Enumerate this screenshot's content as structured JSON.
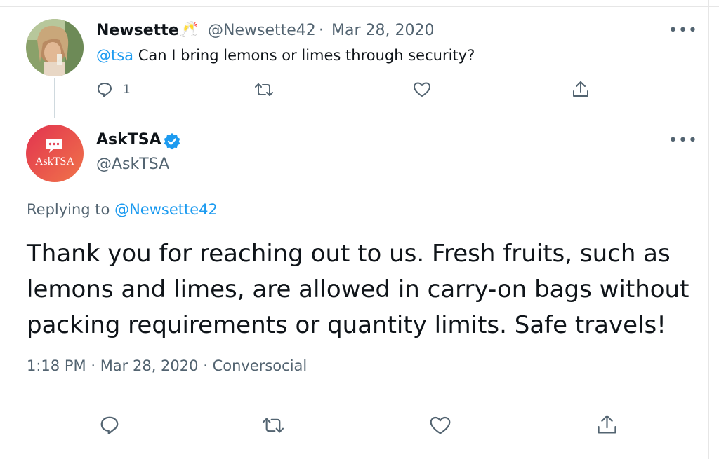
{
  "original_tweet": {
    "display_name": "Newsette",
    "emoji": "🥂",
    "handle": "@Newsette42",
    "separator": "·",
    "date": "Mar 28, 2020",
    "mention": "@tsa",
    "text": "Can I bring lemons or limes through security?",
    "reply_count": "1",
    "more_label": "•••"
  },
  "reply_tweet": {
    "display_name": "AskTSA",
    "verified_icon": "verified-badge-icon",
    "handle": "@AskTSA",
    "avatar_text": "AskTSA",
    "more_label": "•••",
    "replying_prefix": "Replying to",
    "replying_handle": "@Newsette42",
    "text": "Thank you for reaching out to us. Fresh fruits, such as lemons and limes, are allowed in carry-on bags without packing requirements or quantity limits. Safe travels!",
    "time": "1:18 PM",
    "date": "Mar 28, 2020",
    "source": "Conversocial",
    "separator": "·"
  },
  "colors": {
    "link": "#1d9bf0",
    "secondary_text": "#536471",
    "primary_text": "#0f1419",
    "avatar_gradient_start": "#e2334f",
    "avatar_gradient_end": "#f0744a"
  },
  "icons": [
    "reply-icon",
    "retweet-icon",
    "like-icon",
    "share-icon",
    "verified-badge-icon",
    "chat-bubble-icon"
  ]
}
